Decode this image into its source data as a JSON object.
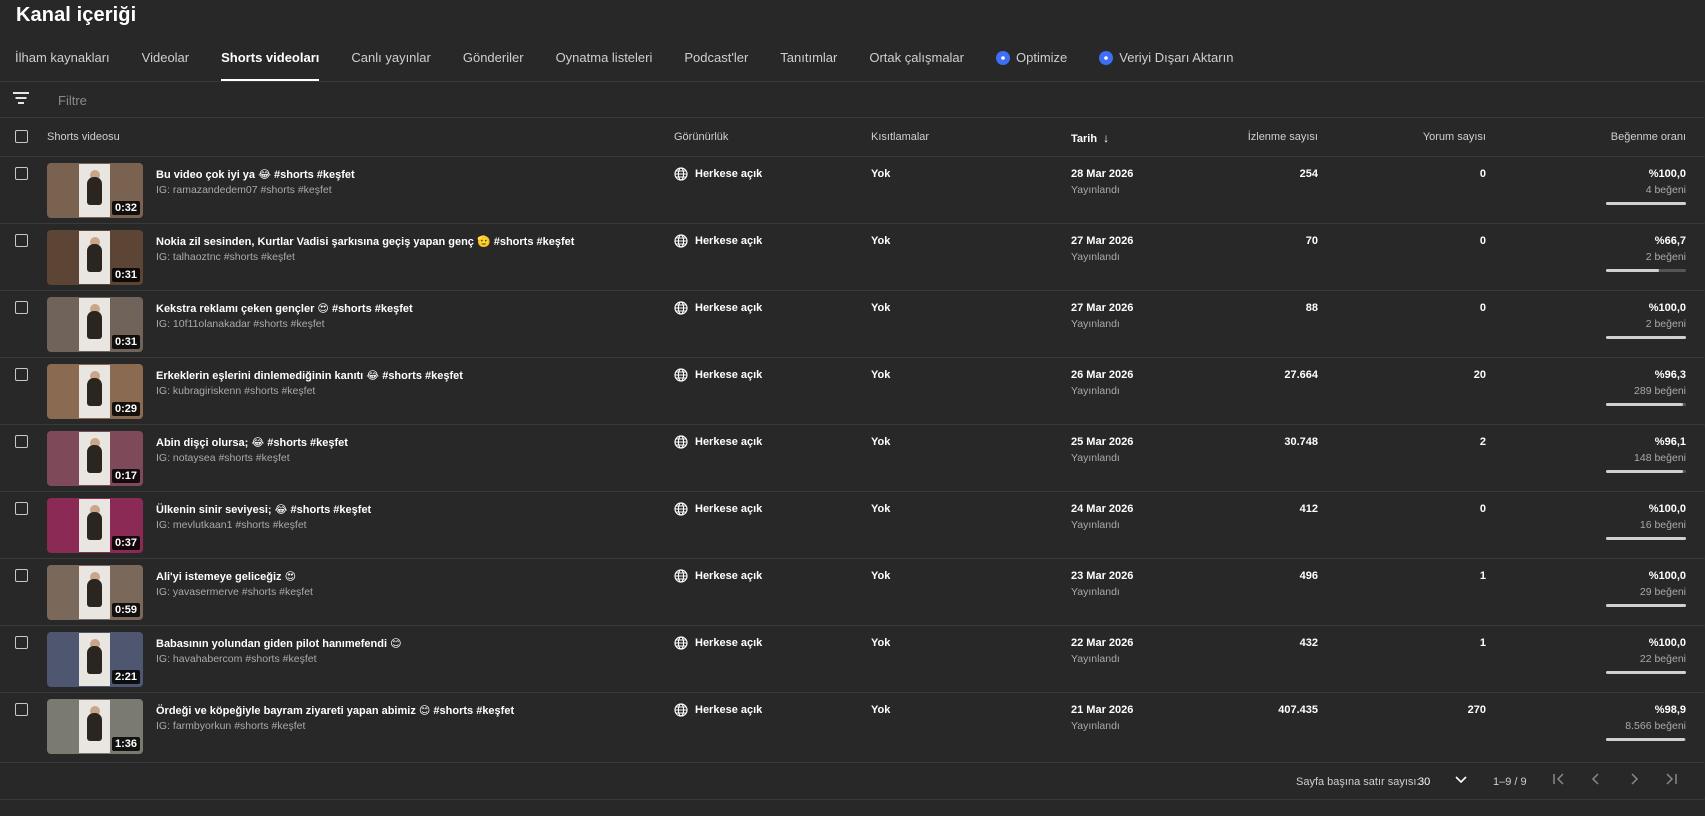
{
  "page": {
    "title": "Kanal içeriği"
  },
  "tabs": [
    {
      "label": "İlham kaynakları"
    },
    {
      "label": "Videolar"
    },
    {
      "label": "Shorts videoları",
      "active": true
    },
    {
      "label": "Canlı yayınlar"
    },
    {
      "label": "Gönderiler"
    },
    {
      "label": "Oynatma listeleri"
    },
    {
      "label": "Podcast'ler"
    },
    {
      "label": "Tanıtımlar"
    },
    {
      "label": "Ortak çalışmalar"
    },
    {
      "label": "Optimize",
      "badge": true
    },
    {
      "label": "Veriyi Dışarı Aktarın",
      "badge": true
    }
  ],
  "filter": {
    "placeholder": "Filtre"
  },
  "columns": {
    "video": "Shorts videosu",
    "visibility": "Görünürlük",
    "restrictions": "Kısıtlamalar",
    "date": "Tarih",
    "views": "İzlenme sayısı",
    "comments": "Yorum sayısı",
    "like_ratio": "Beğenme oranı"
  },
  "rows": [
    {
      "thumb_color": "#7a6250",
      "duration": "0:32",
      "title": "Bu video çok iyi ya 😂 #shorts #keşfet",
      "desc": "IG: ramazandedem07 #shorts #keşfet",
      "visibility": "Herkese açık",
      "restrictions": "Yok",
      "date": "28 Mar 2026",
      "status": "Yayınlandı",
      "views": "254",
      "comments": "0",
      "ratio": "%100,0",
      "likes": "4 beğeni",
      "ratio_value": 100.0
    },
    {
      "thumb_color": "#5c4535",
      "duration": "0:31",
      "title": "Nokia zil sesinden, Kurtlar Vadisi şarkısına geçiş yapan genç 🫡 #shorts #keşfet",
      "desc": "IG: talhaoztnc #shorts #keşfet",
      "visibility": "Herkese açık",
      "restrictions": "Yok",
      "date": "27 Mar 2026",
      "status": "Yayınlandı",
      "views": "70",
      "comments": "0",
      "ratio": "%66,7",
      "likes": "2 beğeni",
      "ratio_value": 66.7
    },
    {
      "thumb_color": "#6f635a",
      "duration": "0:31",
      "title": "Kekstra reklamı çeken gençler 😍 #shorts #keşfet",
      "desc": "IG: 10f11olanakadar #shorts #keşfet",
      "visibility": "Herkese açık",
      "restrictions": "Yok",
      "date": "27 Mar 2026",
      "status": "Yayınlandı",
      "views": "88",
      "comments": "0",
      "ratio": "%100,0",
      "likes": "2 beğeni",
      "ratio_value": 100.0
    },
    {
      "thumb_color": "#8a6a50",
      "duration": "0:29",
      "title": "Erkeklerin eşlerini dinlemediğinin kanıtı 😂 #shorts #keşfet",
      "desc": "IG: kubragiriskenn #shorts #keşfet",
      "visibility": "Herkese açık",
      "restrictions": "Yok",
      "date": "26 Mar 2026",
      "status": "Yayınlandı",
      "views": "27.664",
      "comments": "20",
      "ratio": "%96,3",
      "likes": "289 beğeni",
      "ratio_value": 96.3
    },
    {
      "thumb_color": "#7e4a5a",
      "duration": "0:17",
      "title": "Abin dişçi olursa; 😂 #shorts #keşfet",
      "desc": "IG: notaysea #shorts #keşfet",
      "visibility": "Herkese açık",
      "restrictions": "Yok",
      "date": "25 Mar 2026",
      "status": "Yayınlandı",
      "views": "30.748",
      "comments": "2",
      "ratio": "%96,1",
      "likes": "148 beğeni",
      "ratio_value": 96.1
    },
    {
      "thumb_color": "#8a2a55",
      "duration": "0:37",
      "title": "Ülkenin sinir seviyesi; 😂 #shorts #keşfet",
      "desc": "IG: mevlutkaan1 #shorts #keşfet",
      "visibility": "Herkese açık",
      "restrictions": "Yok",
      "date": "24 Mar 2026",
      "status": "Yayınlandı",
      "views": "412",
      "comments": "0",
      "ratio": "%100,0",
      "likes": "16 beğeni",
      "ratio_value": 100.0
    },
    {
      "thumb_color": "#7a685a",
      "duration": "0:59",
      "title": "Ali'yi istemeye geliceğiz 😍",
      "desc": "IG: yavasermerve #shorts #keşfet",
      "visibility": "Herkese açık",
      "restrictions": "Yok",
      "date": "23 Mar 2026",
      "status": "Yayınlandı",
      "views": "496",
      "comments": "1",
      "ratio": "%100,0",
      "likes": "29 beğeni",
      "ratio_value": 100.0
    },
    {
      "thumb_color": "#4e5670",
      "duration": "2:21",
      "title": "Babasının yolundan giden pilot hanımefendi 😊",
      "desc": "IG: havahabercom #shorts #keşfet",
      "visibility": "Herkese açık",
      "restrictions": "Yok",
      "date": "22 Mar 2026",
      "status": "Yayınlandı",
      "views": "432",
      "comments": "1",
      "ratio": "%100,0",
      "likes": "22 beğeni",
      "ratio_value": 100.0
    },
    {
      "thumb_color": "#7a7a70",
      "duration": "1:36",
      "title": "Ördeği ve köpeğiyle bayram ziyareti yapan abimiz 😊 #shorts #keşfet",
      "desc": "IG: farmbyorkun #shorts #keşfet",
      "visibility": "Herkese açık",
      "restrictions": "Yok",
      "date": "21 Mar 2026",
      "status": "Yayınlandı",
      "views": "407.435",
      "comments": "270",
      "ratio": "%98,9",
      "likes": "8.566 beğeni",
      "ratio_value": 98.9
    }
  ],
  "pager": {
    "rows_label": "Sayfa başına satır sayısı:",
    "rows_per_page": "30",
    "range": "1–9 / 9"
  },
  "icons": [
    "filter-icon",
    "checkbox-icon",
    "sort-down-arrow-icon",
    "globe-icon",
    "chevron-down-icon",
    "first-page-icon",
    "prev-page-icon",
    "next-page-icon",
    "last-page-icon"
  ],
  "colors": {
    "background": "#282828",
    "divider": "#3a3a3a",
    "badge": "#3d6ef5"
  }
}
